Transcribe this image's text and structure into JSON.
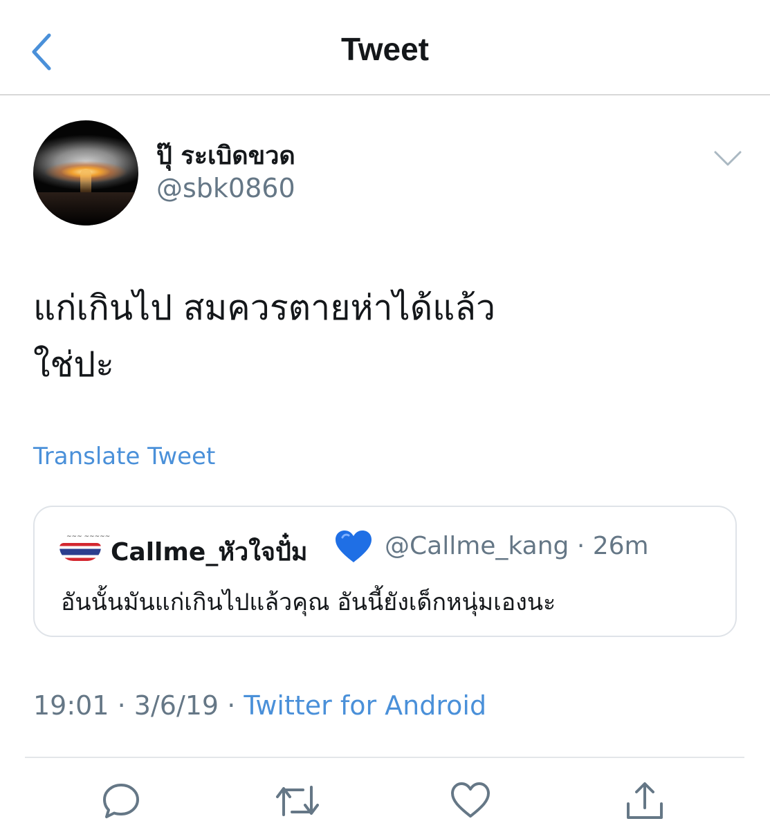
{
  "header": {
    "title": "Tweet",
    "back_icon": "chevron-left-icon"
  },
  "tweet": {
    "display_name": "ปุ๊ ระเบิดขวด",
    "handle": "@sbk0860",
    "text_line1": "แก่เกินไป สมควรตายห่าได้แล้ว",
    "text_line2": "ใช่ปะ",
    "translate_label": "Translate Tweet",
    "time": "19:01",
    "date": "3/6/19",
    "source": "Twitter for Android",
    "separator": "·"
  },
  "quoted_tweet": {
    "display_name": "Callme_หัวใจปั๋ม",
    "handle": "@Callme_kang",
    "age": "26m",
    "separator": "·",
    "text": "อันนั้นมันแก่เกินไปแล้วคุณ อันนี้ยังเด็กหนุ่มเองนะ",
    "emoji": "blue-heart"
  },
  "actions": [
    "reply-icon",
    "retweet-icon",
    "like-icon",
    "share-icon"
  ],
  "colors": {
    "link": "#4a90d9",
    "secondary_text": "#657786",
    "primary_text": "#14171a",
    "heart": "#1f6fe5"
  }
}
